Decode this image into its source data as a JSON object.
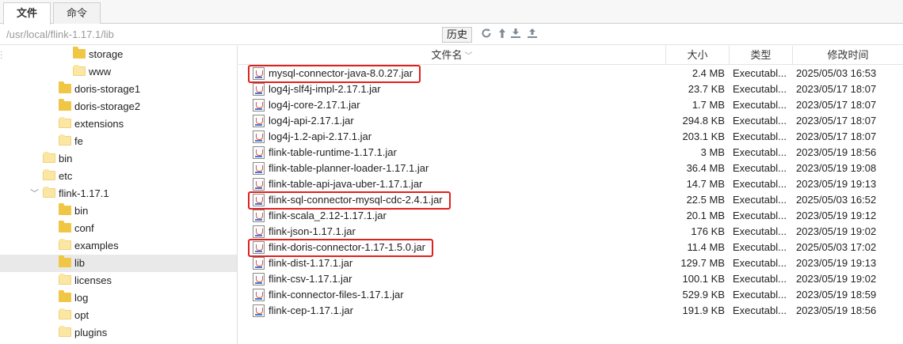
{
  "tabs": [
    {
      "label": "文件",
      "active": true
    },
    {
      "label": "命令",
      "active": false
    }
  ],
  "toolbar": {
    "path": "/usr/local/flink-1.17.1/lib",
    "history_label": "历史",
    "icons": [
      "refresh-icon",
      "up-arrow-icon",
      "download-icon",
      "upload-icon"
    ]
  },
  "tree": [
    {
      "label": "storage",
      "indent": 3,
      "folder": "yellow"
    },
    {
      "label": "www",
      "indent": 3,
      "folder": "light"
    },
    {
      "label": "doris-storage1",
      "indent": 2,
      "folder": "yellow"
    },
    {
      "label": "doris-storage2",
      "indent": 2,
      "folder": "yellow"
    },
    {
      "label": "extensions",
      "indent": 2,
      "folder": "light"
    },
    {
      "label": "fe",
      "indent": 2,
      "folder": "light"
    },
    {
      "label": "bin",
      "indent": 1,
      "folder": "light"
    },
    {
      "label": "etc",
      "indent": 1,
      "folder": "light"
    },
    {
      "label": "flink-1.17.1",
      "indent": 1,
      "folder": "light",
      "expanded": true
    },
    {
      "label": "bin",
      "indent": 2,
      "folder": "yellow"
    },
    {
      "label": "conf",
      "indent": 2,
      "folder": "yellow"
    },
    {
      "label": "examples",
      "indent": 2,
      "folder": "light"
    },
    {
      "label": "lib",
      "indent": 2,
      "folder": "yellow",
      "selected": true
    },
    {
      "label": "licenses",
      "indent": 2,
      "folder": "light"
    },
    {
      "label": "log",
      "indent": 2,
      "folder": "yellow"
    },
    {
      "label": "opt",
      "indent": 2,
      "folder": "light"
    },
    {
      "label": "plugins",
      "indent": 2,
      "folder": "light"
    }
  ],
  "columns": {
    "name": "文件名",
    "size": "大小",
    "type": "类型",
    "mtime": "修改时间"
  },
  "files": [
    {
      "name": "mysql-connector-java-8.0.27.jar",
      "size": "2.4 MB",
      "type": "Executabl...",
      "mtime": "2025/05/03 16:53",
      "highlighted": true
    },
    {
      "name": "log4j-slf4j-impl-2.17.1.jar",
      "size": "23.7 KB",
      "type": "Executabl...",
      "mtime": "2023/05/17 18:07"
    },
    {
      "name": "log4j-core-2.17.1.jar",
      "size": "1.7 MB",
      "type": "Executabl...",
      "mtime": "2023/05/17 18:07"
    },
    {
      "name": "log4j-api-2.17.1.jar",
      "size": "294.8 KB",
      "type": "Executabl...",
      "mtime": "2023/05/17 18:07"
    },
    {
      "name": "log4j-1.2-api-2.17.1.jar",
      "size": "203.1 KB",
      "type": "Executabl...",
      "mtime": "2023/05/17 18:07"
    },
    {
      "name": "flink-table-runtime-1.17.1.jar",
      "size": "3 MB",
      "type": "Executabl...",
      "mtime": "2023/05/19 18:56"
    },
    {
      "name": "flink-table-planner-loader-1.17.1.jar",
      "size": "36.4 MB",
      "type": "Executabl...",
      "mtime": "2023/05/19 19:08"
    },
    {
      "name": "flink-table-api-java-uber-1.17.1.jar",
      "size": "14.7 MB",
      "type": "Executabl...",
      "mtime": "2023/05/19 19:13"
    },
    {
      "name": "flink-sql-connector-mysql-cdc-2.4.1.jar",
      "size": "22.5 MB",
      "type": "Executabl...",
      "mtime": "2025/05/03 16:52",
      "highlighted": true
    },
    {
      "name": "flink-scala_2.12-1.17.1.jar",
      "size": "20.1 MB",
      "type": "Executabl...",
      "mtime": "2023/05/19 19:12"
    },
    {
      "name": "flink-json-1.17.1.jar",
      "size": "176 KB",
      "type": "Executabl...",
      "mtime": "2023/05/19 19:02"
    },
    {
      "name": "flink-doris-connector-1.17-1.5.0.jar",
      "size": "11.4 MB",
      "type": "Executabl...",
      "mtime": "2025/05/03 17:02",
      "highlighted": true
    },
    {
      "name": "flink-dist-1.17.1.jar",
      "size": "129.7 MB",
      "type": "Executabl...",
      "mtime": "2023/05/19 19:13"
    },
    {
      "name": "flink-csv-1.17.1.jar",
      "size": "100.1 KB",
      "type": "Executabl...",
      "mtime": "2023/05/19 19:02"
    },
    {
      "name": "flink-connector-files-1.17.1.jar",
      "size": "529.9 KB",
      "type": "Executabl...",
      "mtime": "2023/05/19 18:59"
    },
    {
      "name": "flink-cep-1.17.1.jar",
      "size": "191.9 KB",
      "type": "Executabl...",
      "mtime": "2023/05/19 18:56"
    }
  ],
  "colors": {
    "highlight": "#e0201d",
    "folder": "#f0c645",
    "selected_row": "#e9e9e9"
  }
}
